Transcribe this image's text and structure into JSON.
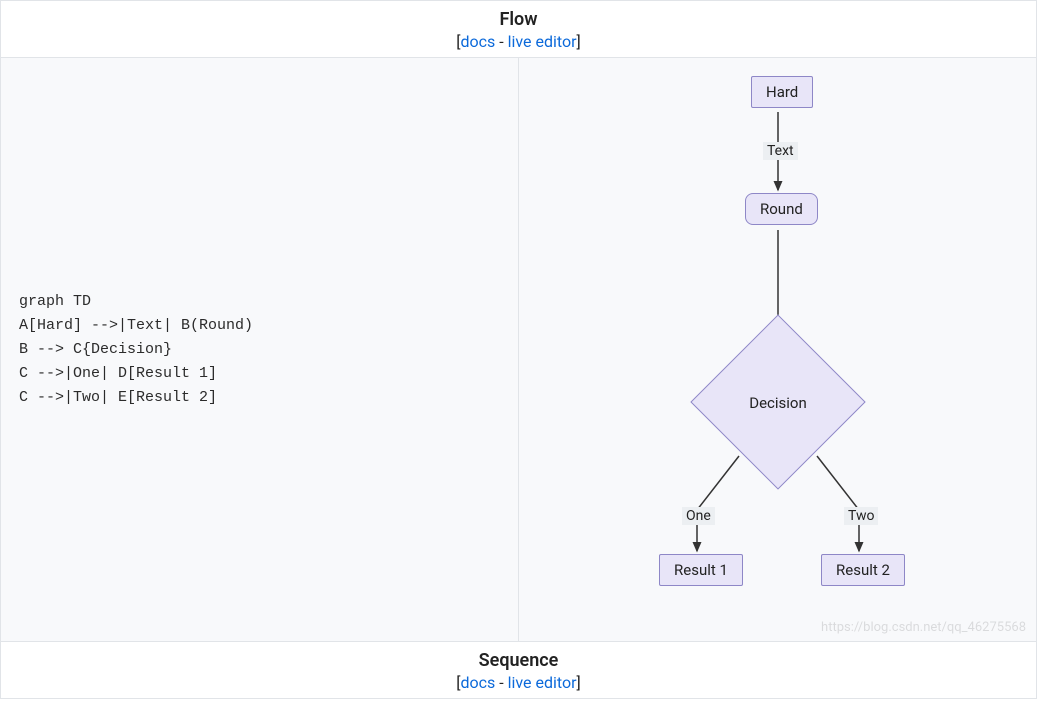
{
  "sections": {
    "flow": {
      "title": "Flow",
      "links": {
        "open": "[",
        "docs": "docs",
        "sep": " - ",
        "live": "live editor",
        "close": "]"
      }
    },
    "sequence": {
      "title": "Sequence",
      "links": {
        "open": "[",
        "docs": "docs",
        "sep": " - ",
        "live": "live editor",
        "close": "]"
      }
    }
  },
  "code": "graph TD\nA[Hard] -->|Text| B(Round)\nB --> C{Decision}\nC -->|One| D[Result 1]\nC -->|Two| E[Result 2]",
  "diagram": {
    "nodes": {
      "A": {
        "id": "A",
        "label": "Hard",
        "shape": "rect"
      },
      "B": {
        "id": "B",
        "label": "Round",
        "shape": "round"
      },
      "C": {
        "id": "C",
        "label": "Decision",
        "shape": "diamond"
      },
      "D": {
        "id": "D",
        "label": "Result 1",
        "shape": "rect"
      },
      "E": {
        "id": "E",
        "label": "Result 2",
        "shape": "rect"
      }
    },
    "edges": [
      {
        "from": "A",
        "to": "B",
        "label": "Text"
      },
      {
        "from": "B",
        "to": "C",
        "label": ""
      },
      {
        "from": "C",
        "to": "D",
        "label": "One"
      },
      {
        "from": "C",
        "to": "E",
        "label": "Two"
      }
    ],
    "colors": {
      "node_fill": "#e8e5f8",
      "node_stroke": "#8e87c7",
      "edge_label_bg": "#eceff2",
      "arrow": "#333"
    }
  },
  "watermark": "https://blog.csdn.net/qq_46275568"
}
